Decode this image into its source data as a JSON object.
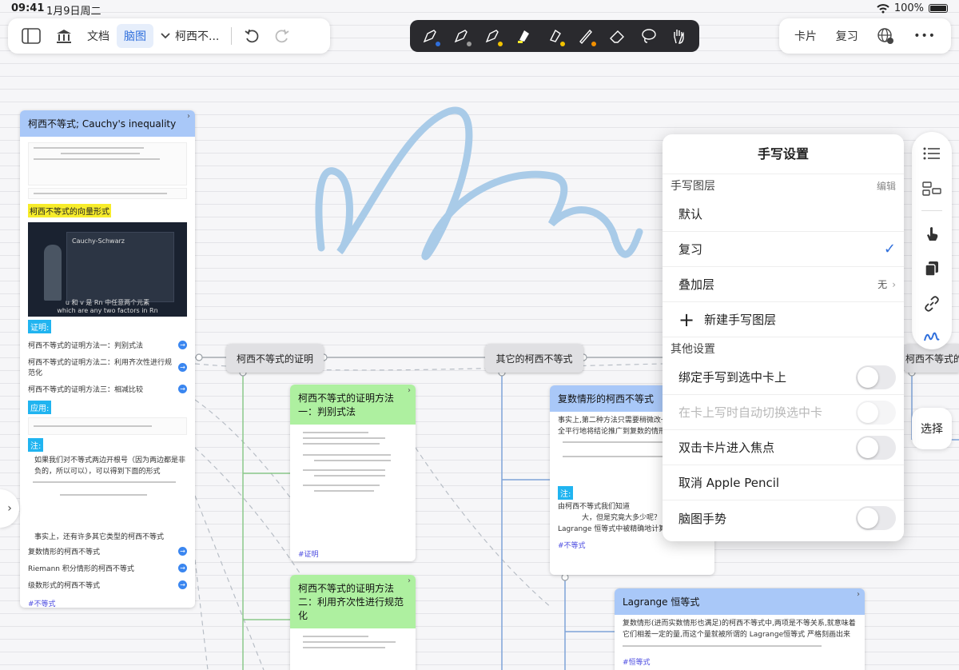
{
  "status": {
    "time": "09:41",
    "date": "1月9日周二",
    "battery": "100%"
  },
  "toolbar": {
    "doc": "文档",
    "mindmap": "脑图",
    "current": "柯西不...",
    "right": [
      "卡片",
      "复习"
    ],
    "more": "•••"
  },
  "pens": [
    {
      "icon": "fountain-pen-icon",
      "dot": "#2f6fdc"
    },
    {
      "icon": "pen-icon",
      "dot": "#9a9a9a"
    },
    {
      "icon": "pen-yellow-icon",
      "dot": "#f2c300"
    },
    {
      "icon": "highlighter-icon",
      "dot": "#f7ec2a"
    },
    {
      "icon": "highlighter-2-icon",
      "dot": "#f2c300"
    },
    {
      "icon": "pencil-icon",
      "dot": "#f29000"
    },
    {
      "icon": "eraser-icon",
      "dot": null
    },
    {
      "icon": "lasso-icon",
      "dot": null
    },
    {
      "icon": "hand-gesture-icon",
      "dot": null
    }
  ],
  "main_card": {
    "title": "柯西不等式; Cauchy's inequality",
    "vector_form": "柯西不等式的向量形式",
    "video": {
      "board_title": "Cauchy-Schwarz",
      "sub_line1": "u 和 v 是 Rn 中任意两个元素",
      "sub_line2": "which are any two factors in Rn"
    },
    "proof_label": "证明:",
    "proofs": [
      "柯西不等式的证明方法一：判别式法",
      "柯西不等式的证明方法二：利用齐次性进行规范化",
      "柯西不等式的证明方法三：相减比较"
    ],
    "apply_label": "应用:",
    "note_label": "注:",
    "note_text": "如果我们对不等式两边开根号（因为两边都是非负的，所以可以），可以得到下面的形式",
    "note_text2": "事实上，还有许多其它类型的柯西不等式",
    "links": [
      "复数情形的柯西不等式",
      "Riemann 积分情形的柯西不等式",
      "级数形式的柯西不等式"
    ],
    "tag": "#不等式"
  },
  "nodes": {
    "proof": "柯西不等式的证明",
    "other": "其它的柯西不等式",
    "partial": "柯西不等式的推"
  },
  "card_method1": {
    "title": "柯西不等式的证明方法一：判别式法",
    "tag": "#证明"
  },
  "card_method2": {
    "title": "柯西不等式的证明方法二：利用齐次性进行规范化"
  },
  "card_complex": {
    "title": "复数情形的柯西不等式",
    "text1": "事实上,第二种方法只需要稍微改一点",
    "text2": "全平行地将结论推广到复数的情形:",
    "note_label": "注:",
    "note1": "由柯西不等式我们知道",
    "note2": "大，但是究竟大多少呢？",
    "note3": "Lagrange 恒等式中被精确地计算出来。",
    "tag": "#不等式"
  },
  "card_lagrange": {
    "title": "Lagrange 恒等式",
    "text": "复数情形(进而实数情形也满足)的柯西不等式中,两项是不等关系,就意味着它们相差一定的量,而这个量就被所谓的 Lagrange恒等式 严格刻画出来",
    "tag": "#恒等式"
  },
  "panel": {
    "title": "手写设置",
    "layers_label": "手写图层",
    "edit": "编辑",
    "layers": [
      "默认",
      "复习"
    ],
    "overlay": "叠加层",
    "overlay_value": "无",
    "new_layer": "新建手写图层",
    "other_label": "其他设置",
    "bind": "绑定手写到选中卡上",
    "auto_switch": "在卡上写时自动切换选中卡",
    "double_tap": "双击卡片进入焦点",
    "cancel_pencil": "取消 Apple Pencil",
    "gesture": "脑图手势"
  },
  "select_button": "选择",
  "colors": {
    "accent": "#2f6fdc",
    "card_blue": "#a9c8f8",
    "card_green": "#aef0a0",
    "stroke": "#a9cbe8"
  }
}
